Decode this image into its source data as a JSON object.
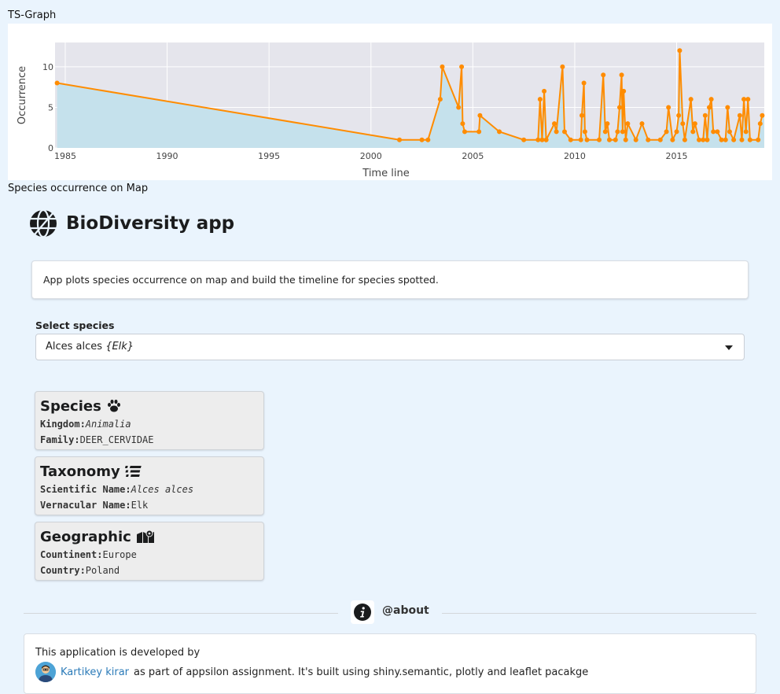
{
  "sections": {
    "ts_graph_label": "TS-Graph",
    "map_label": "Species occurrence on Map"
  },
  "chart_data": {
    "type": "area",
    "xlabel": "Time line",
    "ylabel": "Occurrence",
    "xlim": [
      1984.5,
      2019.3
    ],
    "ylim": [
      0,
      13
    ],
    "x_ticks": [
      1985,
      1990,
      1995,
      2000,
      2005,
      2010,
      2015
    ],
    "y_ticks": [
      0,
      5,
      10
    ],
    "grid": true,
    "line_color": "#ff8c00",
    "fill_color": "#c5e1ec",
    "x": [
      1984.6,
      2001.4,
      2002.5,
      2002.8,
      2003.4,
      2003.5,
      2004.3,
      2004.45,
      2004.5,
      2004.6,
      2005.3,
      2005.35,
      2006.3,
      2007.5,
      2008.2,
      2008.3,
      2008.4,
      2008.5,
      2008.6,
      2009.0,
      2009.1,
      2009.4,
      2009.5,
      2009.8,
      2010.3,
      2010.35,
      2010.45,
      2010.5,
      2010.6,
      2011.2,
      2011.4,
      2011.5,
      2011.6,
      2011.7,
      2012.0,
      2012.1,
      2012.2,
      2012.3,
      2012.35,
      2012.4,
      2012.5,
      2012.6,
      2013.0,
      2013.3,
      2013.6,
      2014.2,
      2014.5,
      2014.6,
      2014.8,
      2015.0,
      2015.1,
      2015.15,
      2015.3,
      2015.4,
      2015.7,
      2015.8,
      2015.9,
      2016.1,
      2016.3,
      2016.4,
      2016.5,
      2016.6,
      2016.7,
      2016.8,
      2017.0,
      2017.2,
      2017.4,
      2017.5,
      2017.6,
      2017.8,
      2018.1,
      2018.2,
      2018.3,
      2018.4,
      2018.5,
      2018.6,
      2019.0,
      2019.1,
      2019.2
    ],
    "y": [
      8,
      1,
      1,
      1,
      6,
      10,
      5,
      10,
      3,
      2,
      2,
      4,
      2,
      1,
      1,
      6,
      1,
      7,
      1,
      3,
      2,
      10,
      2,
      1,
      1,
      4,
      8,
      2,
      1,
      1,
      9,
      2,
      3,
      1,
      1,
      2,
      5,
      9,
      2,
      7,
      1,
      3,
      1,
      3,
      1,
      1,
      2,
      5,
      1,
      2,
      4,
      12,
      3,
      1,
      6,
      2,
      3,
      1,
      1,
      4,
      1,
      5,
      6,
      2,
      2,
      1,
      1,
      5,
      2,
      1,
      4,
      1,
      6,
      2,
      6,
      1,
      1,
      3,
      4
    ]
  },
  "app": {
    "title": "BioDiversity app",
    "description": "App plots species occurrence on map and build the timeline for species spotted."
  },
  "select": {
    "label": "Select species",
    "value_main": "Alces alces ",
    "value_italic": "{Elk}"
  },
  "cards": {
    "species": {
      "title": "Species",
      "kingdom_key": "Kingdom:",
      "kingdom_val": "Animalia",
      "family_key": "Family:",
      "family_val": "DEER_CERVIDAE"
    },
    "taxonomy": {
      "title": "Taxonomy",
      "scientific_key": "Scientific Name:",
      "scientific_val": "Alces alces",
      "vernacular_key": "Vernacular Name:",
      "vernacular_val": "Elk"
    },
    "geographic": {
      "title": "Geographic",
      "continent_key": "Countinent:",
      "continent_val": "Europe",
      "country_key": "Country:",
      "country_val": "Poland"
    }
  },
  "about": {
    "label": "@about",
    "line1": "This application is developed by",
    "author": "Kartikey kirar",
    "line2_rest": "as part of appsilon assignment. It's built using shiny.semantic, plotly and leaflet pacakge"
  }
}
